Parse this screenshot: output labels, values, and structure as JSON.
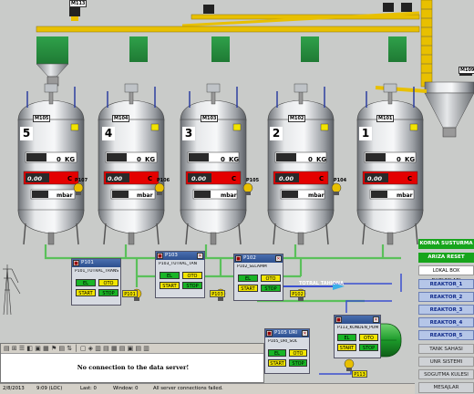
{
  "vessels": [
    {
      "number": "5",
      "motor": "M105",
      "agitator": "",
      "kg": "0",
      "temp": "0.00",
      "unit": "C",
      "pressure": "mbar"
    },
    {
      "number": "4",
      "motor": "M104",
      "agitator": "",
      "kg": "0",
      "temp": "0.00",
      "unit": "C",
      "pressure": "mbar"
    },
    {
      "number": "3",
      "motor": "M103",
      "agitator": "",
      "kg": "0",
      "temp": "0.00",
      "unit": "C",
      "pressure": "mbar"
    },
    {
      "number": "2",
      "motor": "M102",
      "agitator": "",
      "kg": "0",
      "temp": "0.00",
      "unit": "C",
      "pressure": "mbar"
    },
    {
      "number": "1",
      "motor": "M101",
      "agitator": "",
      "kg": "0",
      "temp": "0.00",
      "unit": "C",
      "pressure": "mbar"
    }
  ],
  "kg_label": "KG",
  "top_motors": [
    "M113",
    "M109"
  ],
  "pump_tags": [
    "P107",
    "P106",
    "P105",
    "P104",
    "P101",
    "P103",
    "P102",
    "P113"
  ],
  "flow_label": "TOTRAL TAHIONA",
  "right_menu": {
    "korna": "KORNA SUSTURMA",
    "ariza": "ARIZA RESET",
    "lokal": "LOKAL BOX DURUMLARI",
    "reaktors": [
      "REAKTOR_1",
      "REAKTOR_2",
      "REAKTOR_3",
      "REAKTOR_4",
      "REAKTOR_5"
    ],
    "tank": "TANK SAHASI",
    "unr": "UNR SISTEMI",
    "sogutma": "SOGUTMA KULESI",
    "mesajlar": "MESAJLAR"
  },
  "panels": [
    {
      "title": "P101",
      "label": "P101_TUTRAL_TRANS",
      "el": "EL",
      "oto": "OTO",
      "start": "START",
      "stop": "STOP",
      "badge": "P101"
    },
    {
      "title": "P103",
      "label": "P103_TUTRAL_TAN",
      "el": "EL",
      "oto": "OTO",
      "start": "START",
      "stop": "STOP",
      "badge": "P103"
    },
    {
      "title": "P102",
      "label": "P102_SELAMM",
      "el": "EL",
      "oto": "OTO",
      "start": "START",
      "stop": "STOP",
      "badge": "P102"
    },
    {
      "title": "P105 URI",
      "label": "P105_URI_SOL",
      "el": "EL",
      "oto": "OTO",
      "start": "START",
      "stop": "STOP",
      "badge": ""
    },
    {
      "title": "",
      "label": "P113_KONDEN_POM",
      "el": "EL",
      "oto": "OTO",
      "start": "START",
      "stop": "STOP",
      "badge": "P113"
    }
  ],
  "message": "No connection to the data server!",
  "status": {
    "date": "2/8/2013",
    "time": "9:09 (LOC)",
    "last": "Last: 0",
    "window": "Window: 0",
    "info": "All server connections failed."
  },
  "colors": {
    "red": "#e40000",
    "green": "#17a51c",
    "blue_pipe": "#3a4fd0",
    "pipe_green": "#5ac05a",
    "yellow": "#f2e400",
    "conveyor": "#e8c000"
  }
}
